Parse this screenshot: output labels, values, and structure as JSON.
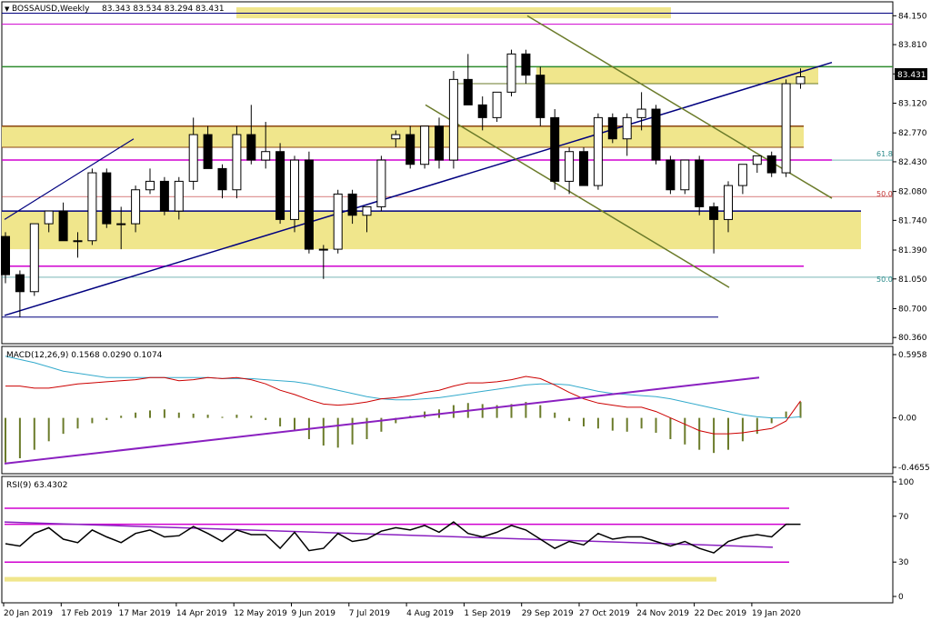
{
  "header": {
    "symbol": "BOSSAUSD,Weekly",
    "ohlc": "83.343 83.534 83.294 83.431"
  },
  "chart_data": {
    "type": "candlestick",
    "price_axis": {
      "ticks": [
        84.15,
        83.81,
        83.465,
        83.12,
        82.77,
        82.43,
        82.08,
        81.74,
        81.39,
        81.05,
        80.7,
        80.36
      ],
      "tick_labels": [
        "84.150",
        "83.810",
        "83.465",
        "83.120",
        "82.770",
        "82.430",
        "82.080",
        "81.740",
        "81.390",
        "81.050",
        "80.700",
        "80.360"
      ],
      "last_price_label": "83.431",
      "range": [
        80.33,
        84.25
      ]
    },
    "x_labels": [
      "20 Jan 2019",
      "17 Feb 2019",
      "17 Mar 2019",
      "14 Apr 2019",
      "12 May 2019",
      "9 Jun 2019",
      "7 Jul 2019",
      "4 Aug 2019",
      "1 Sep 2019",
      "29 Sep 2019",
      "27 Oct 2019",
      "24 Nov 2019",
      "22 Dec 2019",
      "19 Jan 2020"
    ],
    "candles": [
      [
        81.55,
        81.6,
        81.0,
        81.1
      ],
      [
        81.1,
        81.15,
        80.6,
        80.9
      ],
      [
        80.9,
        81.7,
        80.85,
        81.7
      ],
      [
        81.7,
        81.85,
        81.6,
        81.85
      ],
      [
        81.85,
        81.95,
        81.5,
        81.5
      ],
      [
        81.5,
        81.6,
        81.3,
        81.5
      ],
      [
        81.5,
        82.35,
        81.45,
        82.3
      ],
      [
        82.3,
        82.35,
        81.65,
        81.7
      ],
      [
        81.7,
        81.9,
        81.4,
        81.7
      ],
      [
        81.7,
        82.15,
        81.6,
        82.1
      ],
      [
        82.1,
        82.35,
        82.05,
        82.2
      ],
      [
        82.2,
        82.25,
        81.8,
        81.85
      ],
      [
        81.85,
        82.25,
        81.75,
        82.2
      ],
      [
        82.2,
        82.95,
        82.1,
        82.75
      ],
      [
        82.75,
        82.85,
        82.35,
        82.35
      ],
      [
        82.35,
        82.4,
        82.0,
        82.1
      ],
      [
        82.1,
        82.85,
        82.0,
        82.75
      ],
      [
        82.75,
        83.1,
        82.4,
        82.45
      ],
      [
        82.45,
        82.9,
        82.35,
        82.55
      ],
      [
        82.55,
        82.65,
        81.7,
        81.75
      ],
      [
        81.75,
        82.5,
        81.6,
        82.45
      ],
      [
        82.45,
        82.55,
        81.35,
        81.4
      ],
      [
        81.4,
        81.45,
        81.05,
        81.4
      ],
      [
        81.4,
        82.1,
        81.35,
        82.05
      ],
      [
        82.05,
        82.1,
        81.7,
        81.8
      ],
      [
        81.8,
        81.9,
        81.6,
        81.9
      ],
      [
        81.9,
        82.5,
        81.85,
        82.45
      ],
      [
        82.7,
        82.8,
        82.6,
        82.75
      ],
      [
        82.75,
        82.85,
        82.35,
        82.4
      ],
      [
        82.4,
        82.85,
        82.35,
        82.85
      ],
      [
        82.85,
        82.95,
        82.35,
        82.45
      ],
      [
        82.45,
        83.5,
        82.35,
        83.4
      ],
      [
        83.4,
        83.7,
        83.1,
        83.1
      ],
      [
        83.1,
        83.2,
        82.8,
        82.95
      ],
      [
        82.95,
        83.25,
        82.9,
        83.25
      ],
      [
        83.25,
        83.75,
        83.2,
        83.7
      ],
      [
        83.7,
        83.75,
        83.35,
        83.45
      ],
      [
        83.45,
        83.55,
        82.85,
        82.95
      ],
      [
        82.95,
        83.05,
        82.1,
        82.2
      ],
      [
        82.2,
        82.6,
        82.05,
        82.55
      ],
      [
        82.55,
        82.6,
        82.15,
        82.15
      ],
      [
        82.15,
        83.0,
        82.1,
        82.95
      ],
      [
        82.95,
        83.0,
        82.65,
        82.7
      ],
      [
        82.7,
        83.0,
        82.5,
        82.95
      ],
      [
        82.95,
        83.25,
        82.8,
        83.05
      ],
      [
        83.05,
        83.1,
        82.4,
        82.45
      ],
      [
        82.45,
        82.5,
        82.05,
        82.1
      ],
      [
        82.1,
        82.45,
        82.05,
        82.45
      ],
      [
        82.45,
        82.5,
        81.8,
        81.9
      ],
      [
        81.9,
        81.95,
        81.35,
        81.75
      ],
      [
        81.75,
        82.2,
        81.6,
        82.15
      ],
      [
        82.15,
        82.4,
        82.05,
        82.4
      ],
      [
        82.4,
        82.5,
        82.3,
        82.5
      ],
      [
        82.5,
        82.55,
        82.25,
        82.3
      ],
      [
        82.3,
        83.4,
        82.25,
        83.35
      ],
      [
        83.35,
        83.53,
        83.29,
        83.431
      ]
    ],
    "fib_labels": [
      "61.8",
      "50.0",
      "50.0"
    ],
    "macd": {
      "label": "MACD(12,26,9) 0.1568 0.0290 0.1074",
      "ticks": [
        "0.5958",
        "0.00",
        "-0.4655"
      ],
      "range": [
        -0.4655,
        0.5958
      ],
      "histogram": [
        -0.42,
        -0.38,
        -0.3,
        -0.22,
        -0.15,
        -0.1,
        -0.05,
        -0.02,
        0.02,
        0.05,
        0.07,
        0.08,
        0.05,
        0.04,
        0.03,
        0.01,
        0.03,
        0.02,
        -0.02,
        -0.08,
        -0.12,
        -0.2,
        -0.26,
        -0.28,
        -0.25,
        -0.2,
        -0.13,
        -0.05,
        0.02,
        0.06,
        0.08,
        0.12,
        0.14,
        0.13,
        0.12,
        0.13,
        0.15,
        0.12,
        0.05,
        -0.03,
        -0.08,
        -0.1,
        -0.12,
        -0.13,
        -0.1,
        -0.14,
        -0.2,
        -0.25,
        -0.3,
        -0.33,
        -0.3,
        -0.22,
        -0.15,
        -0.05,
        0.06,
        0.15
      ],
      "signal": [
        0.58,
        0.55,
        0.52,
        0.48,
        0.44,
        0.42,
        0.4,
        0.38,
        0.38,
        0.38,
        0.38,
        0.38,
        0.38,
        0.38,
        0.38,
        0.37,
        0.37,
        0.37,
        0.36,
        0.35,
        0.34,
        0.32,
        0.29,
        0.26,
        0.23,
        0.2,
        0.18,
        0.17,
        0.17,
        0.18,
        0.19,
        0.21,
        0.23,
        0.25,
        0.27,
        0.29,
        0.31,
        0.32,
        0.32,
        0.31,
        0.28,
        0.25,
        0.23,
        0.22,
        0.21,
        0.2,
        0.18,
        0.15,
        0.12,
        0.09,
        0.06,
        0.03,
        0.01,
        0.0,
        0.0,
        0.01
      ],
      "macd_line": [
        0.3,
        0.3,
        0.28,
        0.28,
        0.3,
        0.32,
        0.33,
        0.34,
        0.35,
        0.36,
        0.38,
        0.38,
        0.35,
        0.36,
        0.38,
        0.37,
        0.38,
        0.36,
        0.32,
        0.26,
        0.22,
        0.17,
        0.13,
        0.12,
        0.13,
        0.15,
        0.18,
        0.19,
        0.21,
        0.24,
        0.26,
        0.3,
        0.33,
        0.33,
        0.34,
        0.36,
        0.39,
        0.37,
        0.31,
        0.24,
        0.18,
        0.14,
        0.12,
        0.1,
        0.1,
        0.06,
        0.0,
        -0.06,
        -0.12,
        -0.15,
        -0.15,
        -0.14,
        -0.12,
        -0.1,
        -0.03,
        0.16
      ]
    },
    "rsi": {
      "label": "RSI(9) 63.4302",
      "ticks": [
        "100",
        "70",
        "30",
        "0"
      ],
      "range": [
        0,
        100
      ],
      "levels": [
        77,
        63,
        30
      ],
      "values": [
        46,
        44,
        55,
        60,
        50,
        47,
        58,
        52,
        47,
        55,
        58,
        52,
        53,
        61,
        55,
        48,
        58,
        54,
        54,
        42,
        56,
        40,
        42,
        55,
        48,
        50,
        57,
        60,
        58,
        62,
        56,
        65,
        55,
        52,
        56,
        62,
        58,
        50,
        42,
        48,
        45,
        55,
        50,
        52,
        52,
        48,
        44,
        48,
        42,
        38,
        48,
        52,
        54,
        52,
        63,
        63
      ]
    }
  },
  "colors": {
    "bull": "#ffffff",
    "bear": "#000000",
    "zone": "#f0e68c",
    "magenta": "#d000d0",
    "navy": "#00007f",
    "olive": "#6b7b2a",
    "green": "#2e8b2e",
    "brown": "#8b4513",
    "purple": "#8a20c0",
    "red": "#cc0000",
    "cyan": "#33aacc"
  }
}
